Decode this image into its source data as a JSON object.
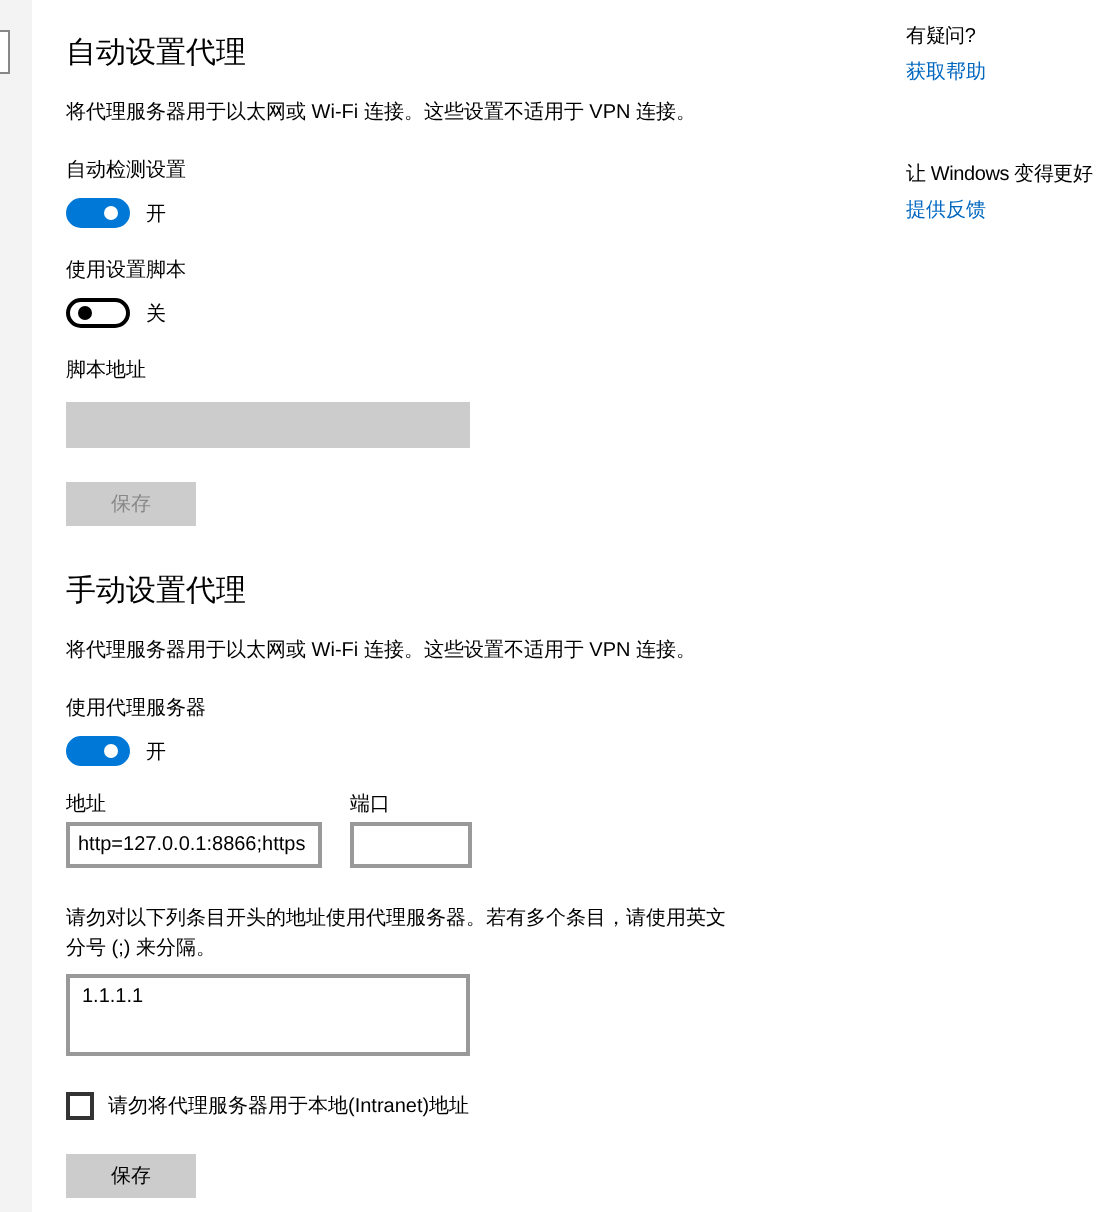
{
  "sections": [
    {
      "title": "自动设置代理",
      "description": "将代理服务器用于以太网或 Wi-Fi 连接。这些设置不适用于 VPN 连接。",
      "controls": [
        {
          "kind": "toggle",
          "label": "自动检测设置",
          "on": true,
          "state_text": "开"
        },
        {
          "kind": "toggle",
          "label": "使用设置脚本",
          "on": false,
          "state_text": "关"
        },
        {
          "kind": "field",
          "label": "脚本地址",
          "disabled": true
        },
        {
          "kind": "button",
          "label": "保存",
          "disabled": true
        }
      ]
    },
    {
      "title": "手动设置代理",
      "description": "将代理服务器用于以太网或 Wi-Fi 连接。这些设置不适用于 VPN 连接。",
      "controls": [
        {
          "kind": "toggle",
          "label": "使用代理服务器",
          "on": true,
          "state_text": "开"
        },
        {
          "kind": "field_pair",
          "fields": [
            {
              "label": "地址",
              "value": "http=127.0.0.1:8866;https"
            },
            {
              "label": "端口"
            }
          ]
        },
        {
          "kind": "note",
          "text": "请勿对以下列条目开头的地址使用代理服务器。若有多个条目，请使用英文分号 (;) 来分隔。"
        },
        {
          "kind": "textarea",
          "value": "1.1.1.1"
        },
        {
          "kind": "checkbox",
          "label": "请勿将代理服务器用于本地(Intranet)地址",
          "checked": false
        },
        {
          "kind": "button",
          "label": "保存",
          "disabled": false
        }
      ]
    }
  ],
  "side": [
    {
      "text": "有疑问?",
      "link": "获取帮助"
    },
    {
      "text": "让 Windows 变得更好",
      "link": "提供反馈"
    }
  ]
}
